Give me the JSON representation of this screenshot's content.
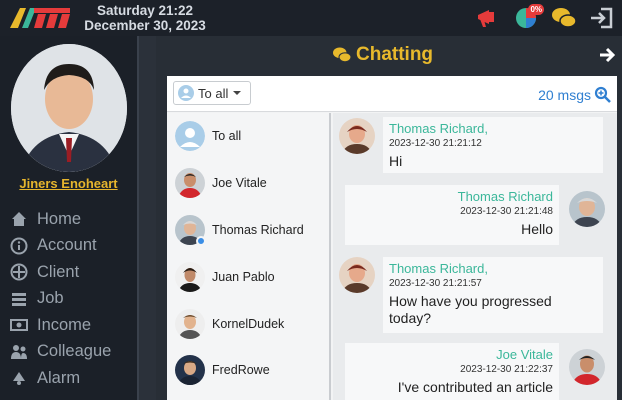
{
  "header": {
    "datetime_line1": "Saturday 21:22",
    "datetime_line2": "December 30, 2023",
    "stats_badge": "0%"
  },
  "profile": {
    "name": "Jiners Enoheart"
  },
  "menu": [
    {
      "label": "Home",
      "icon": "home-icon"
    },
    {
      "label": "Account",
      "icon": "info-icon"
    },
    {
      "label": "Client",
      "icon": "client-icon"
    },
    {
      "label": "Job",
      "icon": "job-icon"
    },
    {
      "label": "Income",
      "icon": "money-icon"
    },
    {
      "label": "Colleague",
      "icon": "colleague-icon"
    },
    {
      "label": "Alarm",
      "icon": "alarm-icon"
    }
  ],
  "chat": {
    "title": "Chatting",
    "recipient": "To all",
    "msg_count": "20 msgs",
    "contacts": [
      {
        "name": "To all"
      },
      {
        "name": "Joe Vitale"
      },
      {
        "name": "Thomas Richard"
      },
      {
        "name": "Juan Pablo"
      },
      {
        "name": "KornelDudek"
      },
      {
        "name": "FredRowe"
      }
    ],
    "messages": [
      {
        "sender": "Thomas Richard,",
        "time": "2023-12-30 21:21:12",
        "text": "Hi",
        "side": "left"
      },
      {
        "sender": "Thomas Richard",
        "time": "2023-12-30 21:21:48",
        "text": "Hello",
        "side": "right"
      },
      {
        "sender": "Thomas Richard,",
        "time": "2023-12-30 21:21:57",
        "text": "How have you progressed today?",
        "side": "left"
      },
      {
        "sender": "Joe Vitale",
        "time": "2023-12-30 21:22:37",
        "text": "I've contributed an article",
        "side": "right"
      }
    ]
  },
  "colors": {
    "accent": "#e8b92c",
    "name_green": "#3bb79a",
    "link_blue": "#2f7fd1"
  }
}
